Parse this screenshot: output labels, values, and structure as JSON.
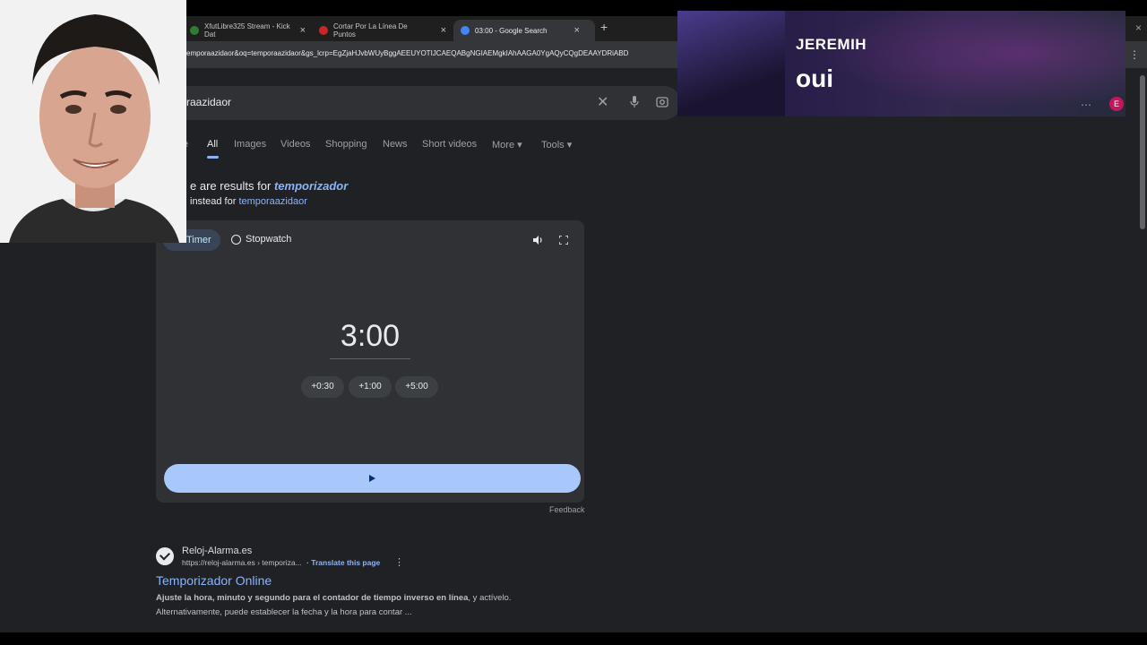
{
  "browser": {
    "tabs": [
      {
        "title": "XfutLibre325 Stream - Kick Dat",
        "color": "#2e7d32"
      },
      {
        "title": "Cortar Por La Línea De Puntos",
        "color": "#c62828"
      },
      {
        "title": "03:00 - Google Search",
        "color": "#4285f4"
      }
    ],
    "new_tab_symbol": "+",
    "close_symbol": "×",
    "url": "emporaazidaor&oq=temporaazidaor&gs_lcrp=EgZjaHJvbWUyBggAEEUYOTIJCAEQABgNGIAEMgkIAhAAGA0YgAQyCQgDEAAYDRiABD",
    "menu_symbol": "⋮"
  },
  "search": {
    "query": "raazidaor",
    "clear_symbol": "✕"
  },
  "nav": {
    "partial": "e",
    "all": "All",
    "images": "Images",
    "videos": "Videos",
    "shopping": "Shopping",
    "news": "News",
    "short_videos": "Short videos",
    "more": "More ▾",
    "tools": "Tools ▾"
  },
  "correction": {
    "line1_prefix": "e are results for",
    "line1_term": "temporizador",
    "line2_prefix": "instead for",
    "line2_term": "temporaazidaor"
  },
  "timer": {
    "timer_tab": "Timer",
    "stopwatch_tab": "Stopwatch",
    "time": "3:00",
    "chips": [
      "+0:30",
      "+1:00",
      "+5:00"
    ],
    "feedback": "Feedback"
  },
  "result": {
    "site": "Reloj-Alarma.es",
    "url": "https://reloj-alarma.es › temporiza...",
    "translate": "· Translate this page",
    "dots": "⋮",
    "title": "Temporizador Online",
    "snippet1_bold": "Ajuste la hora, minuto y segundo para el contador de tiempo inverso en línea",
    "snippet1_rest": ", y actívelo.",
    "snippet2": "Alternativamente, puede establecer la fecha y la hora para contar ..."
  },
  "music": {
    "artist": "JEREMIH",
    "song": "oui"
  },
  "account": {
    "avatar_letter": "E",
    "dots": "⋯"
  }
}
